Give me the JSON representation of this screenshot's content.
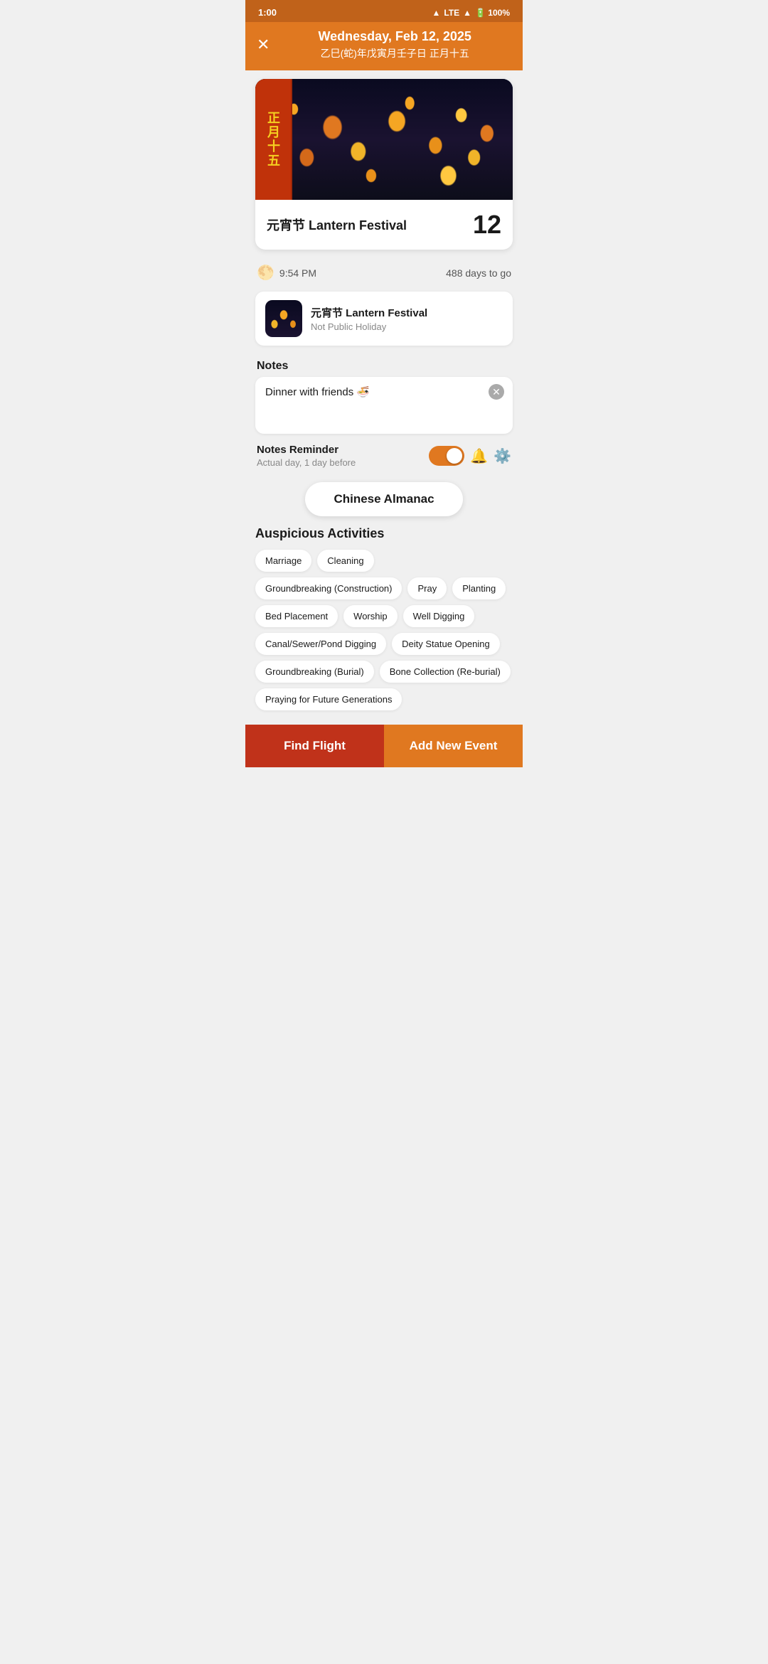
{
  "statusBar": {
    "time": "1:00",
    "icons": "▲ LTE ▲ 🔋 100%"
  },
  "header": {
    "dateLine": "Wednesday, Feb 12, 2025",
    "chineseLine": "乙巳(蛇)年戊寅月壬子日 正月十五"
  },
  "festivalCard": {
    "redTagText": "正月十五",
    "name": "元宵节 Lantern Festival",
    "day": "12"
  },
  "timeRow": {
    "time": "9:54 PM",
    "countdown": "488 days to go"
  },
  "eventEntry": {
    "title": "元宵节 Lantern Festival",
    "subtitle": "Not Public Holiday"
  },
  "notesSection": {
    "label": "Notes",
    "placeholder": "Dinner with friends 🍜"
  },
  "reminderSection": {
    "title": "Notes Reminder",
    "subtitle": "Actual day, 1 day before"
  },
  "almanacButton": {
    "label": "Chinese Almanac"
  },
  "auspiciousSection": {
    "title": "Auspicious Activities",
    "tags": [
      "Marriage",
      "Cleaning",
      "Groundbreaking (Construction)",
      "Pray",
      "Planting",
      "Bed Placement",
      "Worship",
      "Well Digging",
      "Canal/Sewer/Pond Digging",
      "Deity Statue Opening",
      "Groundbreaking (Burial)",
      "Bone Collection (Re-burial)",
      "Praying for Future Generations"
    ]
  },
  "bottomButtons": {
    "findFlight": "Find Flight",
    "addEvent": "Add New Event"
  }
}
